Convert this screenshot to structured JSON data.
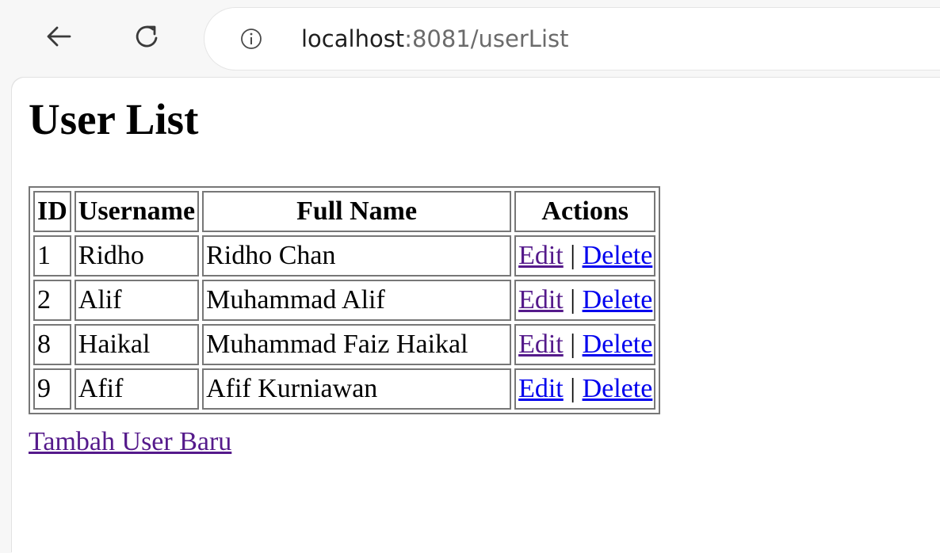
{
  "browser": {
    "url_host": "localhost",
    "url_path": ":8081/userList"
  },
  "page": {
    "title": "User List",
    "table": {
      "headers": [
        "ID",
        "Username",
        "Full Name",
        "Actions"
      ],
      "rows": [
        {
          "id": "1",
          "username": "Ridho",
          "full_name": "Ridho Chan",
          "edit": "Edit",
          "sep": "|",
          "delete": "Delete"
        },
        {
          "id": "2",
          "username": "Alif",
          "full_name": "Muhammad Alif",
          "edit": "Edit",
          "sep": "|",
          "delete": "Delete"
        },
        {
          "id": "8",
          "username": "Haikal",
          "full_name": "Muhammad Faiz Haikal",
          "edit": "Edit",
          "sep": "|",
          "delete": "Delete"
        },
        {
          "id": "9",
          "username": "Afif",
          "full_name": "Afif Kurniawan",
          "edit": "Edit",
          "sep": "|",
          "delete": "Delete"
        }
      ]
    },
    "add_link": "Tambah User Baru"
  },
  "colors": {
    "link": "#0000ee",
    "visited_link": "#551a8b",
    "table_border": "#777777"
  }
}
